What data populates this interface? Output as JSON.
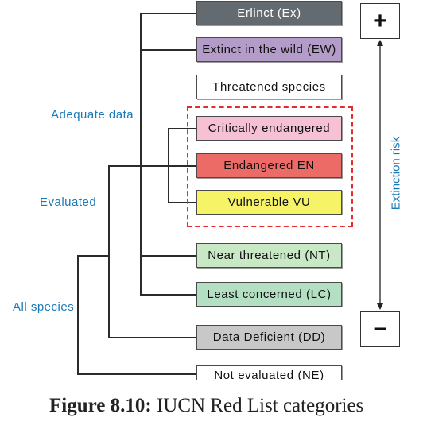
{
  "caption": {
    "bold": "Figure 8.10:",
    "text": " IUCN Red List categories"
  },
  "groups": {
    "adequate_data": "Adequate data",
    "evaluated": "Evaluated",
    "all_species": "All species"
  },
  "categories": [
    {
      "label": "Erlinct (Ex)",
      "color": "#636b70",
      "text_color": "#ffffff"
    },
    {
      "label": "Extinct in the wild (EW)",
      "color": "#b39cc8",
      "text_color": "#111111"
    },
    {
      "label": "Threatened species",
      "color": "#ffffff",
      "text_color": "#111111"
    },
    {
      "label": "Critically endangered",
      "color": "#f6c1d4",
      "text_color": "#111111"
    },
    {
      "label": "Endangered EN",
      "color": "#ec6b66",
      "text_color": "#111111"
    },
    {
      "label": "Vulnerable VU",
      "color": "#f6f366",
      "text_color": "#111111"
    },
    {
      "label": "Near threatened (NT)",
      "color": "#c9e8c6",
      "text_color": "#111111"
    },
    {
      "label": "Least concerned (LC)",
      "color": "#b3e0c2",
      "text_color": "#111111"
    },
    {
      "label": "Data Deficient (DD)",
      "color": "#c8c8c8",
      "text_color": "#111111"
    },
    {
      "label": "Not evaluated (NE)",
      "color": "#ffffff",
      "text_color": "#111111"
    }
  ],
  "risk_axis": {
    "label": "Extinction risk",
    "high": "+",
    "low": "−"
  },
  "colors": {
    "group_label": "#1a7ab8",
    "threatened_outline": "#e22b2b"
  }
}
